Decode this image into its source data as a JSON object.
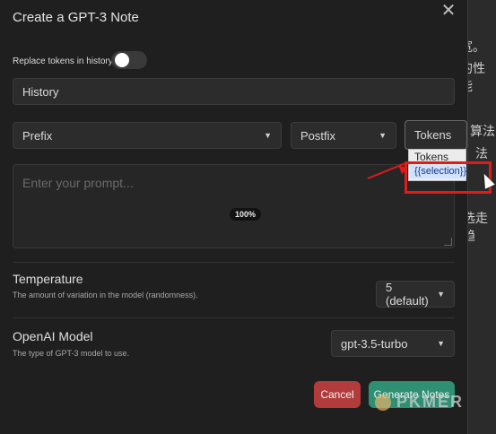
{
  "background": {
    "fragments": [
      "宽。",
      "的性能",
      "算法",
      "法",
      "选走趋"
    ]
  },
  "modal": {
    "title": "Create a GPT-3 Note",
    "close_glyph": "✕",
    "replace_tokens_label": "Replace tokens in history",
    "history_value": "History",
    "prefix_select": "Prefix",
    "postfix_select": "Postfix",
    "tokens_select": "Tokens",
    "prompt_placeholder": "Enter your prompt...",
    "zoom_badge": "100%",
    "temperature": {
      "title": "Temperature",
      "description": "The amount of variation in the model (randomness).",
      "value": "5 (default)"
    },
    "model": {
      "title": "OpenAI Model",
      "description": "The type of GPT-3 model to use.",
      "value": "gpt-3.5-turbo"
    },
    "buttons": {
      "cancel": "Cancel",
      "generate": "Generate Notes"
    }
  },
  "tokens_dropdown": {
    "options": [
      "Tokens",
      "{{selection}}"
    ]
  },
  "watermark": {
    "text": "PKMER"
  },
  "colors": {
    "cancel": "#b23b3b",
    "generate": "#2f8f73",
    "annotation": "#e11a1a"
  }
}
